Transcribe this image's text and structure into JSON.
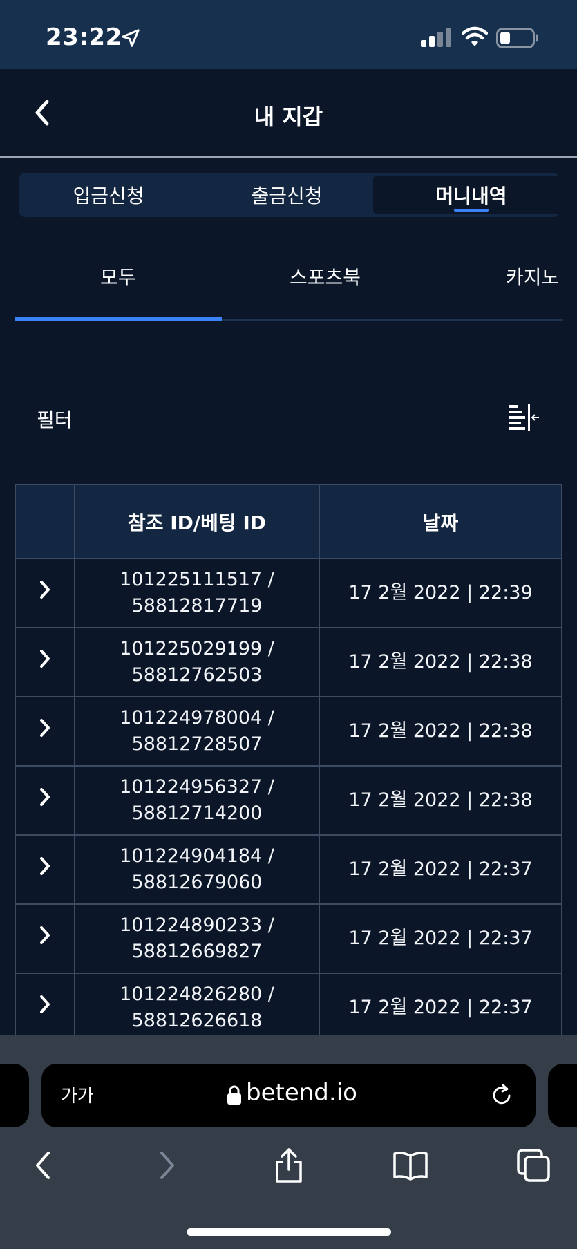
{
  "status_bar": {
    "time": "23:22"
  },
  "header": {
    "title": "내 지갑"
  },
  "segments": [
    {
      "label": "입금신청",
      "active": false
    },
    {
      "label": "출금신청",
      "active": false
    },
    {
      "label": "머니내역",
      "active": true
    }
  ],
  "sub_tabs": [
    {
      "label": "모두",
      "active": true
    },
    {
      "label": "스포츠북",
      "active": false
    },
    {
      "label": "카지노",
      "active": false
    }
  ],
  "filter": {
    "label": "필터"
  },
  "table": {
    "headers": {
      "ref": "참조 ID/베팅 ID",
      "date": "날짜"
    },
    "rows": [
      {
        "ref_line1": "101225111517 /",
        "ref_line2": "58812817719",
        "date": "17 2월 2022 | 22:39"
      },
      {
        "ref_line1": "101225029199 /",
        "ref_line2": "58812762503",
        "date": "17 2월 2022 | 22:38"
      },
      {
        "ref_line1": "101224978004 /",
        "ref_line2": "58812728507",
        "date": "17 2월 2022 | 22:38"
      },
      {
        "ref_line1": "101224956327 /",
        "ref_line2": "58812714200",
        "date": "17 2월 2022 | 22:38"
      },
      {
        "ref_line1": "101224904184 /",
        "ref_line2": "58812679060",
        "date": "17 2월 2022 | 22:37"
      },
      {
        "ref_line1": "101224890233 /",
        "ref_line2": "58812669827",
        "date": "17 2월 2022 | 22:37"
      },
      {
        "ref_line1": "101224826280 /",
        "ref_line2": "58812626618",
        "date": "17 2월 2022 | 22:37"
      }
    ]
  },
  "browser": {
    "text_size_label": "가가",
    "url": "betend.io"
  },
  "colors": {
    "background": "#0b1628",
    "status_bar": "#16304d",
    "accent": "#3b82f6",
    "browser_chrome": "#353d48"
  }
}
